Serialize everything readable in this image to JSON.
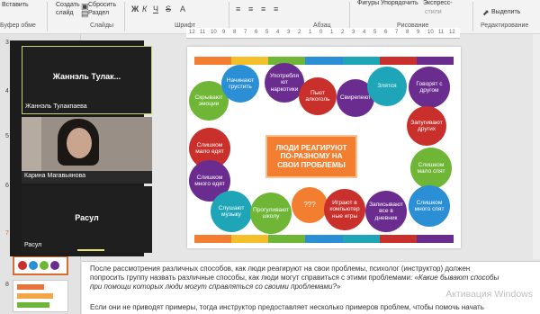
{
  "ribbon": {
    "paste": "Вставить",
    "new_slide_1": "Создать",
    "new_slide_2": "слайд",
    "reset": "Сбросить",
    "section": "Раздел",
    "shapes": "Фигуры",
    "arrange": "Упорядочить",
    "express_1": "Экспресс-",
    "express_2": "стили",
    "select": "Выделить",
    "groups": {
      "clipboard": "Буфер обме",
      "slides": "Слайды",
      "font": "Шрифт",
      "paragraph": "Абзац",
      "drawing": "Рисование",
      "editing": "Редактирование"
    }
  },
  "slide_panel": {
    "numbers": [
      "3",
      "4",
      "5",
      "6",
      "7",
      "8"
    ]
  },
  "ruler": {
    "ticks": [
      "12",
      "11",
      "10",
      "9",
      "8",
      "7",
      "6",
      "5",
      "4",
      "3",
      "2",
      "1",
      "0",
      "1",
      "2",
      "3",
      "4",
      "5",
      "6",
      "7",
      "8",
      "9",
      "10",
      "11",
      "12"
    ]
  },
  "slide": {
    "center": "ЛЮДИ РЕАГИРУЮТ\nПО-РАЗНОМУ НА\nСВОИ ПРОБЛЕМЫ",
    "circles": [
      "Скрывают\nэмоции",
      "Начинают\nгрустить",
      "Употребля\nют\nнаркотики",
      "Пьют\nалкоголь",
      "Свирепеют",
      "Злятся",
      "Говорят с\nдругом",
      "Слишком\nмало едят",
      "Запугивают\nдругих",
      "Слишком\nмного едят",
      "Слишком\nмало спят",
      "Слушают\nмузыку",
      "Прогуливают\nшколу",
      "???",
      "Играют в\nкомпьютер\nные игры",
      "Записывают\nвсе в\nдневник",
      "Слишком\nмного спят"
    ]
  },
  "video": {
    "tile1_big": "Жаннэль  Тулак...",
    "tile1_small": "Жаннэль Тулакпаева",
    "tile2": "Карина Магавьянова",
    "tile3_big": "Расул",
    "tile3_small": "Расул"
  },
  "notes": {
    "line1": "После рассмотрения различных способов, как люди реагируют на свои проблемы, психолог (инструктор) должен",
    "line2": "попросить группу назвать различные способы, как люди могут справиться с этими проблемами: «",
    "line2_italic": "Какие бывают способы",
    "line3_italic": "при помощи которых люди могут справляться со своими проблемами?",
    "line3_end": "»",
    "line5": "Если они не приводят примеры, тогда  инструктор предоставляет несколько примеров проблем, чтобы помочь начать",
    "watermark": "Активация Windows"
  },
  "colors": {
    "orange": "#f37e2f",
    "red": "#c9302c",
    "purple": "#6a2c8f",
    "blue": "#2b8fd6",
    "green": "#6fb536",
    "teal": "#1ea6b8"
  }
}
